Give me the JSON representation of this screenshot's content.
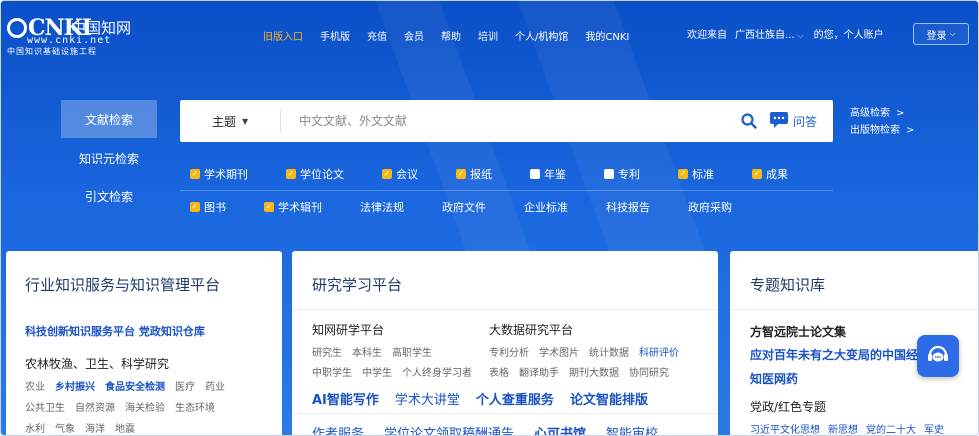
{
  "header": {
    "logo": {
      "brand": "CNKI",
      "script": "中国知网",
      "url": "www.cnki.net",
      "subtitle": "中国知识基础设施工程"
    },
    "nav": [
      "旧版入口",
      "手机版",
      "充值",
      "会员",
      "帮助",
      "培训",
      "个人/机构馆",
      "我的CNKI"
    ],
    "welcome": "欢迎来自",
    "region": "广西壮族自...",
    "greeting": "的您，个人账户",
    "login": "登录"
  },
  "search": {
    "tabs": [
      "文献检索",
      "知识元检索",
      "引文检索"
    ],
    "scope": "主题",
    "placeholder": "中文文献、外文文献",
    "ask": "问答",
    "advanced": "高级检索",
    "publication": "出版物检索"
  },
  "databases": {
    "row1": [
      {
        "label": "学术期刊",
        "checked": true
      },
      {
        "label": "学位论文",
        "checked": true
      },
      {
        "label": "会议",
        "checked": true
      },
      {
        "label": "报纸",
        "checked": true
      },
      {
        "label": "年鉴",
        "checked": false
      },
      {
        "label": "专利",
        "checked": false
      },
      {
        "label": "标准",
        "checked": true
      },
      {
        "label": "成果",
        "checked": true
      }
    ],
    "row2": [
      {
        "label": "图书",
        "checked": true
      },
      {
        "label": "学术辑刊",
        "checked": true
      },
      {
        "label": "法律法规",
        "checked": null
      },
      {
        "label": "政府文件",
        "checked": null
      },
      {
        "label": "企业标准",
        "checked": null
      },
      {
        "label": "科技报告",
        "checked": null
      },
      {
        "label": "政府采购",
        "checked": null
      }
    ]
  },
  "panels": {
    "industry": {
      "title": "行业知识服务与知识管理平台",
      "links": "科技创新知识服务平台  党政知识仓库",
      "heading": "农林牧渔、卫生、科学研究",
      "line1": [
        "农业",
        "乡村振兴",
        "食品安全检测",
        "医疗",
        "药业"
      ],
      "line2": [
        "公共卫生",
        "自然资源",
        "海关检验",
        "生态环境"
      ],
      "line3": [
        "水利",
        "气象",
        "海洋",
        "地震"
      ]
    },
    "research": {
      "title": "研究学习平台",
      "sub1_title": "知网研学平台",
      "sub1_line1": [
        "研究生",
        "本科生",
        "高职学生"
      ],
      "sub1_line2": [
        "中职学生",
        "中学生",
        "个人终身学习者"
      ],
      "sub2_title": "大数据研究平台",
      "sub2_line1": [
        "专利分析",
        "学术图片",
        "统计数据",
        "科研评价"
      ],
      "sub2_line2": [
        "表格",
        "翻译助手",
        "期刊大数据",
        "协同研究"
      ],
      "services": [
        "AI智能写作",
        "学术大讲堂",
        "个人查重服务",
        "论文智能排版"
      ],
      "bottom": [
        "作者服务",
        "学位论文领取稿酬通告",
        "心可书馆",
        "智能审校"
      ]
    },
    "topics": {
      "title": "专题知识库",
      "item1": "方智远院士论文集",
      "item2": "应对百年未有之大变局的中国经济",
      "item3": "知医网药",
      "item4": "党政/红色专题",
      "line": [
        "习近平文化思想",
        "新思想",
        "党的二十大",
        "军史"
      ]
    }
  }
}
